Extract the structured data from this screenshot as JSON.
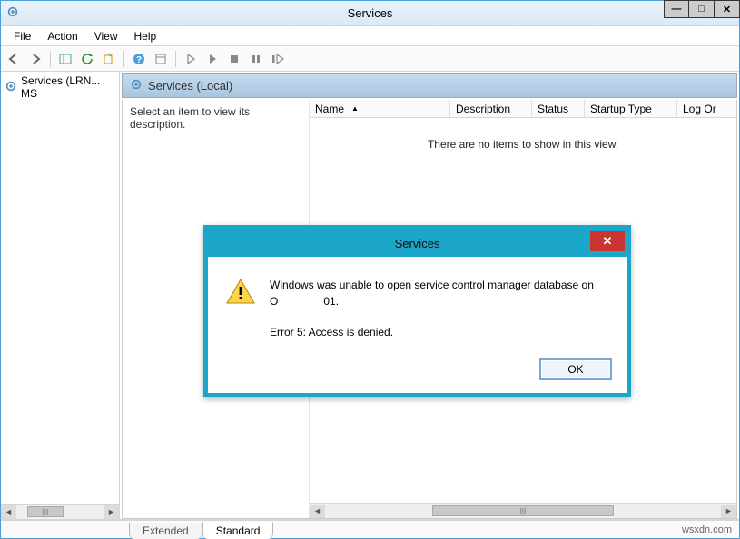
{
  "window": {
    "title": "Services",
    "controls": {
      "min": "—",
      "max": "□",
      "close": "✕"
    }
  },
  "menubar": [
    "File",
    "Action",
    "View",
    "Help"
  ],
  "tree": {
    "item_label": "Services (LRN... MS"
  },
  "detail": {
    "pane_title": "Services (Local)",
    "description_hint": "Select an item to view its description.",
    "empty_message": "There are no items to show in this view.",
    "columns": {
      "name": "Name",
      "description": "Description",
      "status": "Status",
      "startup": "Startup Type",
      "logon": "Log Or"
    }
  },
  "tabs": {
    "extended": "Extended",
    "standard": "Standard"
  },
  "statusbar": {
    "text": "wsxdn.com"
  },
  "dialog": {
    "title": "Services",
    "line1": "Windows was unable to open service control manager database on",
    "line2": "O               01.",
    "line3": "Error 5: Access is denied.",
    "ok": "OK"
  },
  "scroll_thumb_label": "III"
}
